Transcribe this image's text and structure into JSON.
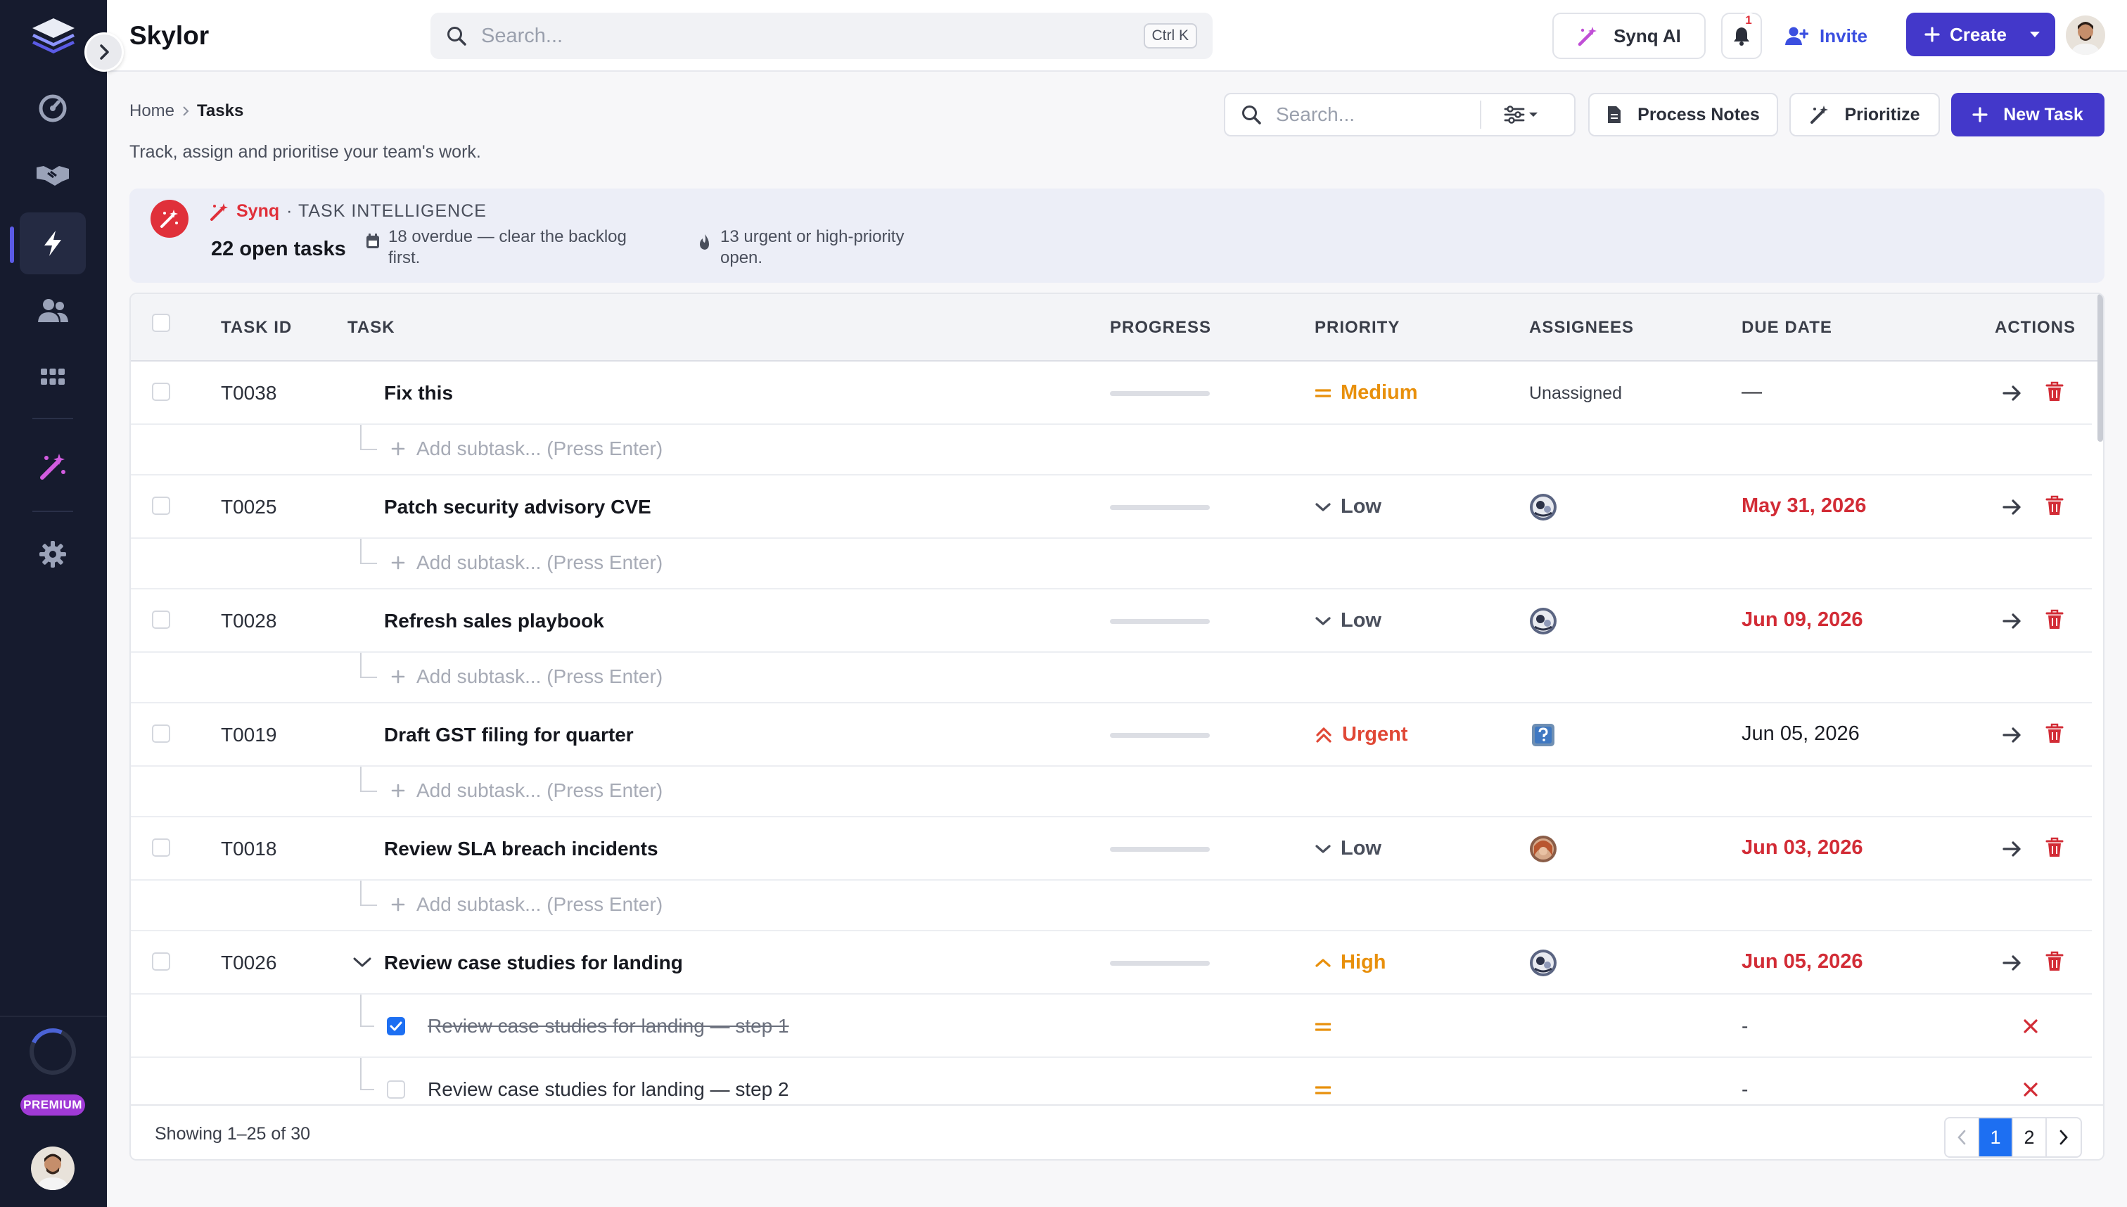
{
  "app": {
    "brand": "Skylor"
  },
  "topbar": {
    "search_placeholder": "Search...",
    "search_shortcut": "Ctrl K",
    "synq_ai_label": "Synq AI",
    "notification_count": "1",
    "invite_label": "Invite",
    "create_label": "Create"
  },
  "sidebar": {
    "items": [
      {
        "icon": "dashboard-icon"
      },
      {
        "icon": "handshake-icon"
      },
      {
        "icon": "bolt-icon",
        "active": true
      },
      {
        "icon": "users-icon"
      },
      {
        "icon": "apps-grid-icon"
      },
      {
        "icon": "magic-wand-icon"
      },
      {
        "icon": "gear-icon"
      }
    ],
    "premium_label": "PREMIUM"
  },
  "page": {
    "breadcrumb_home": "Home",
    "breadcrumb_current": "Tasks",
    "subtitle": "Track, assign and prioritise your team's work.",
    "search_placeholder": "Search...",
    "process_notes_label": "Process Notes",
    "prioritize_label": "Prioritize",
    "new_task_label": "New Task"
  },
  "intelligence": {
    "brand": "Synq",
    "title": "· TASK INTELLIGENCE",
    "open_tasks": "22 open tasks",
    "note_overdue": "18 overdue — clear the backlog first.",
    "note_urgent": "13 urgent or high-priority open."
  },
  "table": {
    "headers": [
      "TASK ID",
      "TASK",
      "PROGRESS",
      "PRIORITY",
      "ASSIGNEES",
      "DUE DATE",
      "ACTIONS"
    ],
    "add_subtask_placeholder": "Add subtask... (Press Enter)",
    "rows": [
      {
        "id": "T0038",
        "name": "Fix this",
        "priority": "Medium",
        "assignee": "Unassigned",
        "due": "—"
      },
      {
        "id": "T0025",
        "name": "Patch security advisory CVE",
        "priority": "Low",
        "assignee": "avatar",
        "due": "May 31, 2026"
      },
      {
        "id": "T0028",
        "name": "Refresh sales playbook",
        "priority": "Low",
        "assignee": "avatar",
        "due": "Jun 09, 2026"
      },
      {
        "id": "T0019",
        "name": "Draft GST filing for quarter",
        "priority": "Urgent",
        "assignee": "unknown-avatar",
        "due": "Jun 05, 2026"
      },
      {
        "id": "T0018",
        "name": "Review SLA breach incidents",
        "priority": "Low",
        "assignee": "avatar",
        "due": "Jun 03, 2026"
      },
      {
        "id": "T0026",
        "name": "Review case studies for landing",
        "priority": "High",
        "assignee": "avatar",
        "due": "Jun 05, 2026"
      }
    ],
    "subtasks": [
      {
        "name": "Review case studies for landing — step 1",
        "done": true,
        "due": "-"
      },
      {
        "name": "Review case studies for landing — step 2",
        "done": false,
        "due": "-"
      }
    ],
    "showing": "Showing 1–25 of 30",
    "pages": [
      "1",
      "2"
    ],
    "current_page": "1"
  },
  "colors": {
    "accent": "#4338ca",
    "danger": "#d22c36",
    "medium": "#e8900c",
    "sidebar_bg": "#161b2e"
  }
}
